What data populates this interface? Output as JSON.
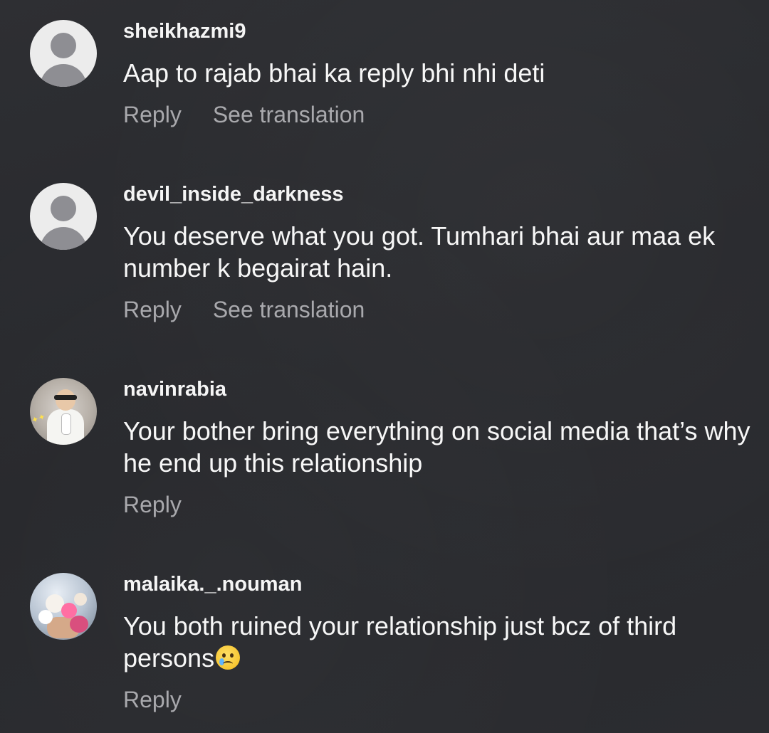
{
  "comments": [
    {
      "username": "sheikhazmi9",
      "avatar": "default-avatar-icon",
      "text": "Aap to rajab bhai ka reply bhi nhi deti",
      "reply_label": "Reply",
      "translate_label": "See translation"
    },
    {
      "username": "devil_inside_darkness",
      "avatar": "default-avatar-icon",
      "text": "You deserve what you got. Tumhari bhai aur maa ek number k begairat hain.",
      "reply_label": "Reply",
      "translate_label": "See translation"
    },
    {
      "username": "navinrabia",
      "avatar": "photo-avatar",
      "text": "Your bother bring everything on social media that’s why he end up this relationship",
      "reply_label": "Reply"
    },
    {
      "username": "malaika._.nouman",
      "avatar": "photo-avatar",
      "text": "You both ruined your relationship just bcz of third persons",
      "emoji": "crying-face-emoji",
      "reply_label": "Reply"
    }
  ]
}
